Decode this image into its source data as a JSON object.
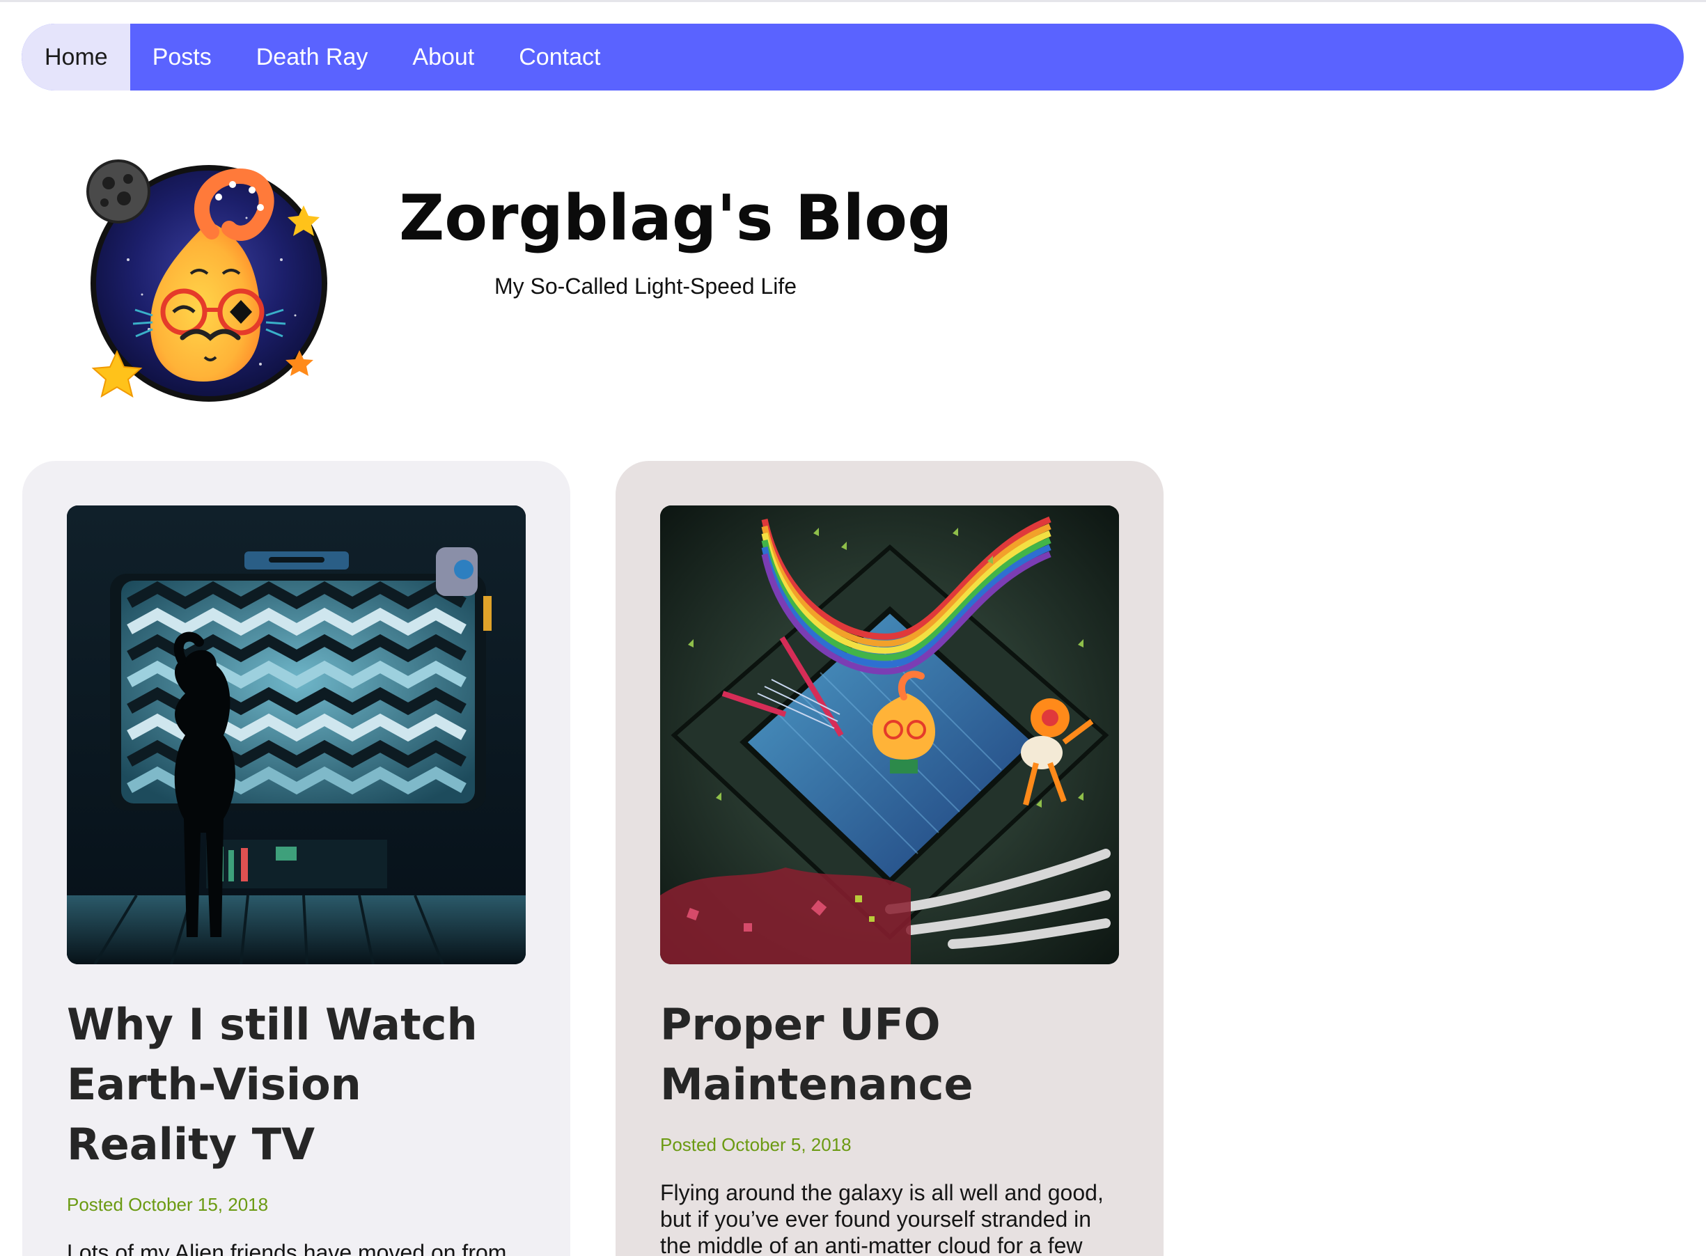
{
  "nav": {
    "items": [
      {
        "label": "Home",
        "active": true
      },
      {
        "label": "Posts",
        "active": false
      },
      {
        "label": "Death Ray",
        "active": false
      },
      {
        "label": "About",
        "active": false
      },
      {
        "label": "Contact",
        "active": false
      }
    ],
    "colors": {
      "bar": "#5a63ff",
      "active_bg": "#e5e4fb"
    }
  },
  "header": {
    "title": "Zorgblag's Blog",
    "tagline": "My So-Called Light-Speed Life",
    "logo_icon": "alien-avatar-logo"
  },
  "posts": [
    {
      "title": "Why I still Watch Earth-Vision Reality TV",
      "posted": "Posted October 15, 2018",
      "excerpt": "Lots of my Alien friends have moved on from",
      "image_icon": "alien-watching-tv-illustration",
      "card_bg": "#f1f0f4"
    },
    {
      "title": "Proper UFO Maintenance",
      "posted": "Posted October 5, 2018",
      "excerpt": "Flying around the galaxy is all well and good, but if you’ve ever found yourself stranded in the middle of an anti-matter cloud for a few",
      "image_icon": "ufo-maintenance-illustration",
      "card_bg": "#e7e1e1"
    }
  ],
  "colors": {
    "date": "#6b9a12",
    "title": "#262626"
  }
}
